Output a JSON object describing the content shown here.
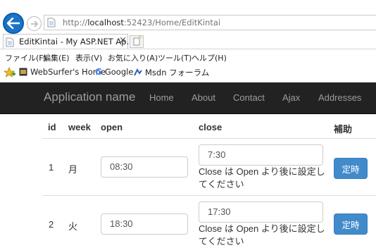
{
  "browser": {
    "url_prefix": "http://",
    "url_host": "localhost",
    "url_rest": ":52423/Home/EditKintai",
    "tab_title": "EditKintai - My ASP.NET Ap...",
    "tab_close": "×",
    "menu": [
      "ファイル(F)",
      "編集(E)",
      "表示(V)",
      "お気に入り(A)",
      "ツール(T)",
      "ヘルプ(H)"
    ],
    "favorites": [
      {
        "label": "WebSurfer's Home",
        "icon": "websurfer-icon"
      },
      {
        "label": "Google",
        "icon": "google-icon"
      },
      {
        "label": "Msdn フォーラム",
        "icon": "msdn-icon"
      }
    ]
  },
  "navbar": {
    "brand": "Application name",
    "links": [
      "Home",
      "About",
      "Contact",
      "Ajax",
      "Addresses"
    ]
  },
  "table": {
    "headers": {
      "id": "id",
      "week": "week",
      "open": "open",
      "close": "close",
      "action": "補助"
    },
    "rows": [
      {
        "id": "1",
        "week": "月",
        "open": "08:30",
        "close": "7:30",
        "error": "Close は Open より後に設定してください",
        "button": "定時"
      },
      {
        "id": "2",
        "week": "火",
        "open": "18:30",
        "close": "17:30",
        "error": "Close は Open より後に設定してください",
        "button": "定時"
      }
    ]
  },
  "colors": {
    "navbar": "#222222",
    "primary": "#428bca",
    "back_button": "#1a73c8"
  }
}
